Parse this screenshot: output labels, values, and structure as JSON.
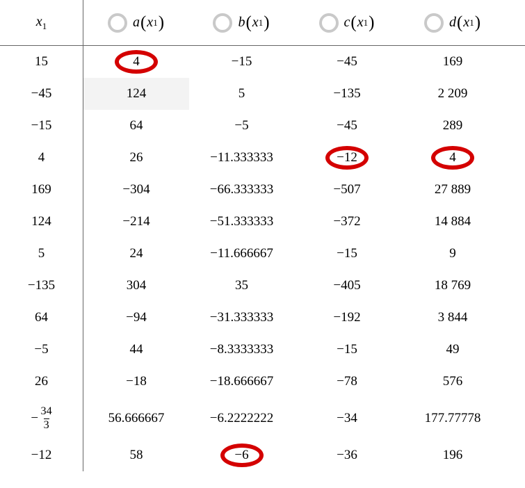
{
  "headers": {
    "col0": {
      "var": "x",
      "sub": "1"
    },
    "col1": {
      "fn": "a",
      "var": "x",
      "sub": "1"
    },
    "col2": {
      "fn": "b",
      "var": "x",
      "sub": "1"
    },
    "col3": {
      "fn": "c",
      "var": "x",
      "sub": "1"
    },
    "col4": {
      "fn": "d",
      "var": "x",
      "sub": "1"
    }
  },
  "rows": [
    {
      "x": "15",
      "a": "4",
      "b": "−15",
      "c": "−45",
      "d": "169",
      "circle_a": true
    },
    {
      "x": "−45",
      "a": "124",
      "b": "5",
      "c": "−135",
      "d": "2 209",
      "highlight_a": true
    },
    {
      "x": "−15",
      "a": "64",
      "b": "−5",
      "c": "−45",
      "d": "289"
    },
    {
      "x": "4",
      "a": "26",
      "b": "−11.333333",
      "c": "−12",
      "d": "4",
      "circle_c": true,
      "circle_d": true
    },
    {
      "x": "169",
      "a": "−304",
      "b": "−66.333333",
      "c": "−507",
      "d": "27 889"
    },
    {
      "x": "124",
      "a": "−214",
      "b": "−51.333333",
      "c": "−372",
      "d": "14 884"
    },
    {
      "x": "5",
      "a": "24",
      "b": "−11.666667",
      "c": "−15",
      "d": "9"
    },
    {
      "x": "−135",
      "a": "304",
      "b": "35",
      "c": "−405",
      "d": "18 769"
    },
    {
      "x": "64",
      "a": "−94",
      "b": "−31.333333",
      "c": "−192",
      "d": "3 844"
    },
    {
      "x": "−5",
      "a": "44",
      "b": "−8.3333333",
      "c": "−15",
      "d": "49"
    },
    {
      "x": "26",
      "a": "−18",
      "b": "−18.666667",
      "c": "−78",
      "d": "576"
    },
    {
      "x_frac": {
        "sign": "−",
        "num": "34",
        "den": "3"
      },
      "a": "56.666667",
      "b": "−6.2222222",
      "c": "−34",
      "d": "177.77778",
      "tall": true
    },
    {
      "x": "−12",
      "a": "58",
      "b": "−6",
      "c": "−36",
      "d": "196",
      "circle_b": true
    }
  ]
}
